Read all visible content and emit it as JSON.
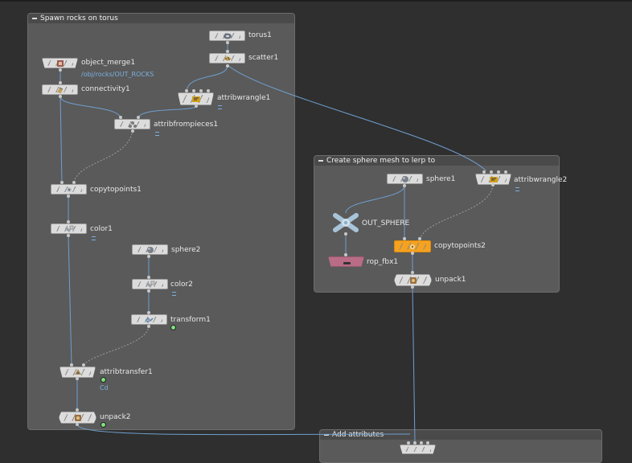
{
  "network_boxes": {
    "spawn_rocks": "Spawn rocks on torus",
    "create_sphere": "Create sphere mesh to lerp to",
    "add_attributes": "Add attributes"
  },
  "nodes": {
    "torus1": "torus1",
    "scatter1": "scatter1",
    "object_merge1": "object_merge1",
    "object_merge1_path": "/obj/rocks/OUT_ROCKS",
    "connectivity1": "connectivity1",
    "attribwrangle1": "attribwrangle1",
    "attribfrompieces1": "attribfrompieces1",
    "copytopoints1": "copytopoints1",
    "color1": "color1",
    "sphere2": "sphere2",
    "color2": "color2",
    "transform1": "transform1",
    "attribtransfer1": "attribtransfer1",
    "attribtransfer1_attr": "Cd",
    "unpack2": "unpack2",
    "sphere1": "sphere1",
    "attribwrangle2": "attribwrangle2",
    "out_sphere": "OUT_SPHERE",
    "copytopoints2": "copytopoints2",
    "rop_fbx1": "rop_fbx1",
    "unpack1": "unpack1"
  },
  "colors": {
    "background": "#2f2f2f",
    "network_box": "#5a5a5a",
    "node_body": "#dcdcdc",
    "display_node": "#f6a21e",
    "rop_node": "#b86c86",
    "wire": "#6f9fcf",
    "display_flag": "#7de17d"
  }
}
